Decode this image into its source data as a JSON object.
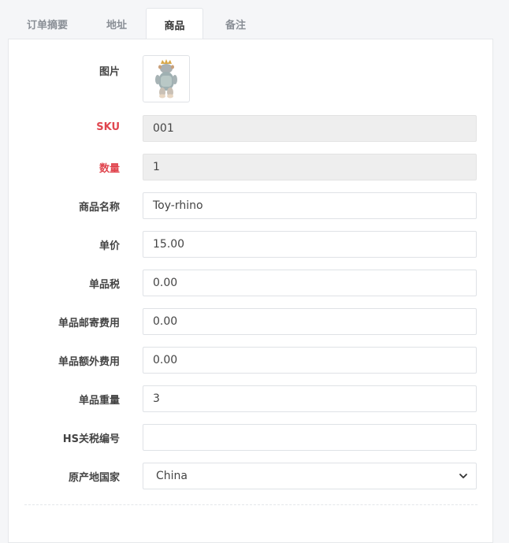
{
  "tabs": [
    {
      "label": "订单摘要",
      "active": false
    },
    {
      "label": "地址",
      "active": false
    },
    {
      "label": "商品",
      "active": true
    },
    {
      "label": "备注",
      "active": false
    }
  ],
  "form": {
    "picture_label": "图片",
    "sku": {
      "label": "SKU",
      "value": "001",
      "required": true,
      "readonly": true
    },
    "quantity": {
      "label": "数量",
      "value": "1",
      "required": true,
      "readonly": true
    },
    "product_name": {
      "label": "商品名称",
      "value": "Toy-rhino"
    },
    "unit_price": {
      "label": "单价",
      "value": "15.00"
    },
    "unit_tax": {
      "label": "单品税",
      "value": "0.00"
    },
    "unit_shipping": {
      "label": "单品邮寄费用",
      "value": "0.00"
    },
    "unit_extra": {
      "label": "单品额外费用",
      "value": "0.00"
    },
    "unit_weight": {
      "label": "单品重量",
      "value": "3"
    },
    "hs_code": {
      "label": "HS关税编号",
      "value": ""
    },
    "origin_country": {
      "label": "原产地国家",
      "value": "China"
    }
  },
  "colors": {
    "required_label": "#e0464f",
    "label": "#444444",
    "readonly_bg": "#eeeeee"
  },
  "icons": {
    "thumbnail": "toy-rhino-image",
    "select_arrow": "chevron-down-icon"
  }
}
